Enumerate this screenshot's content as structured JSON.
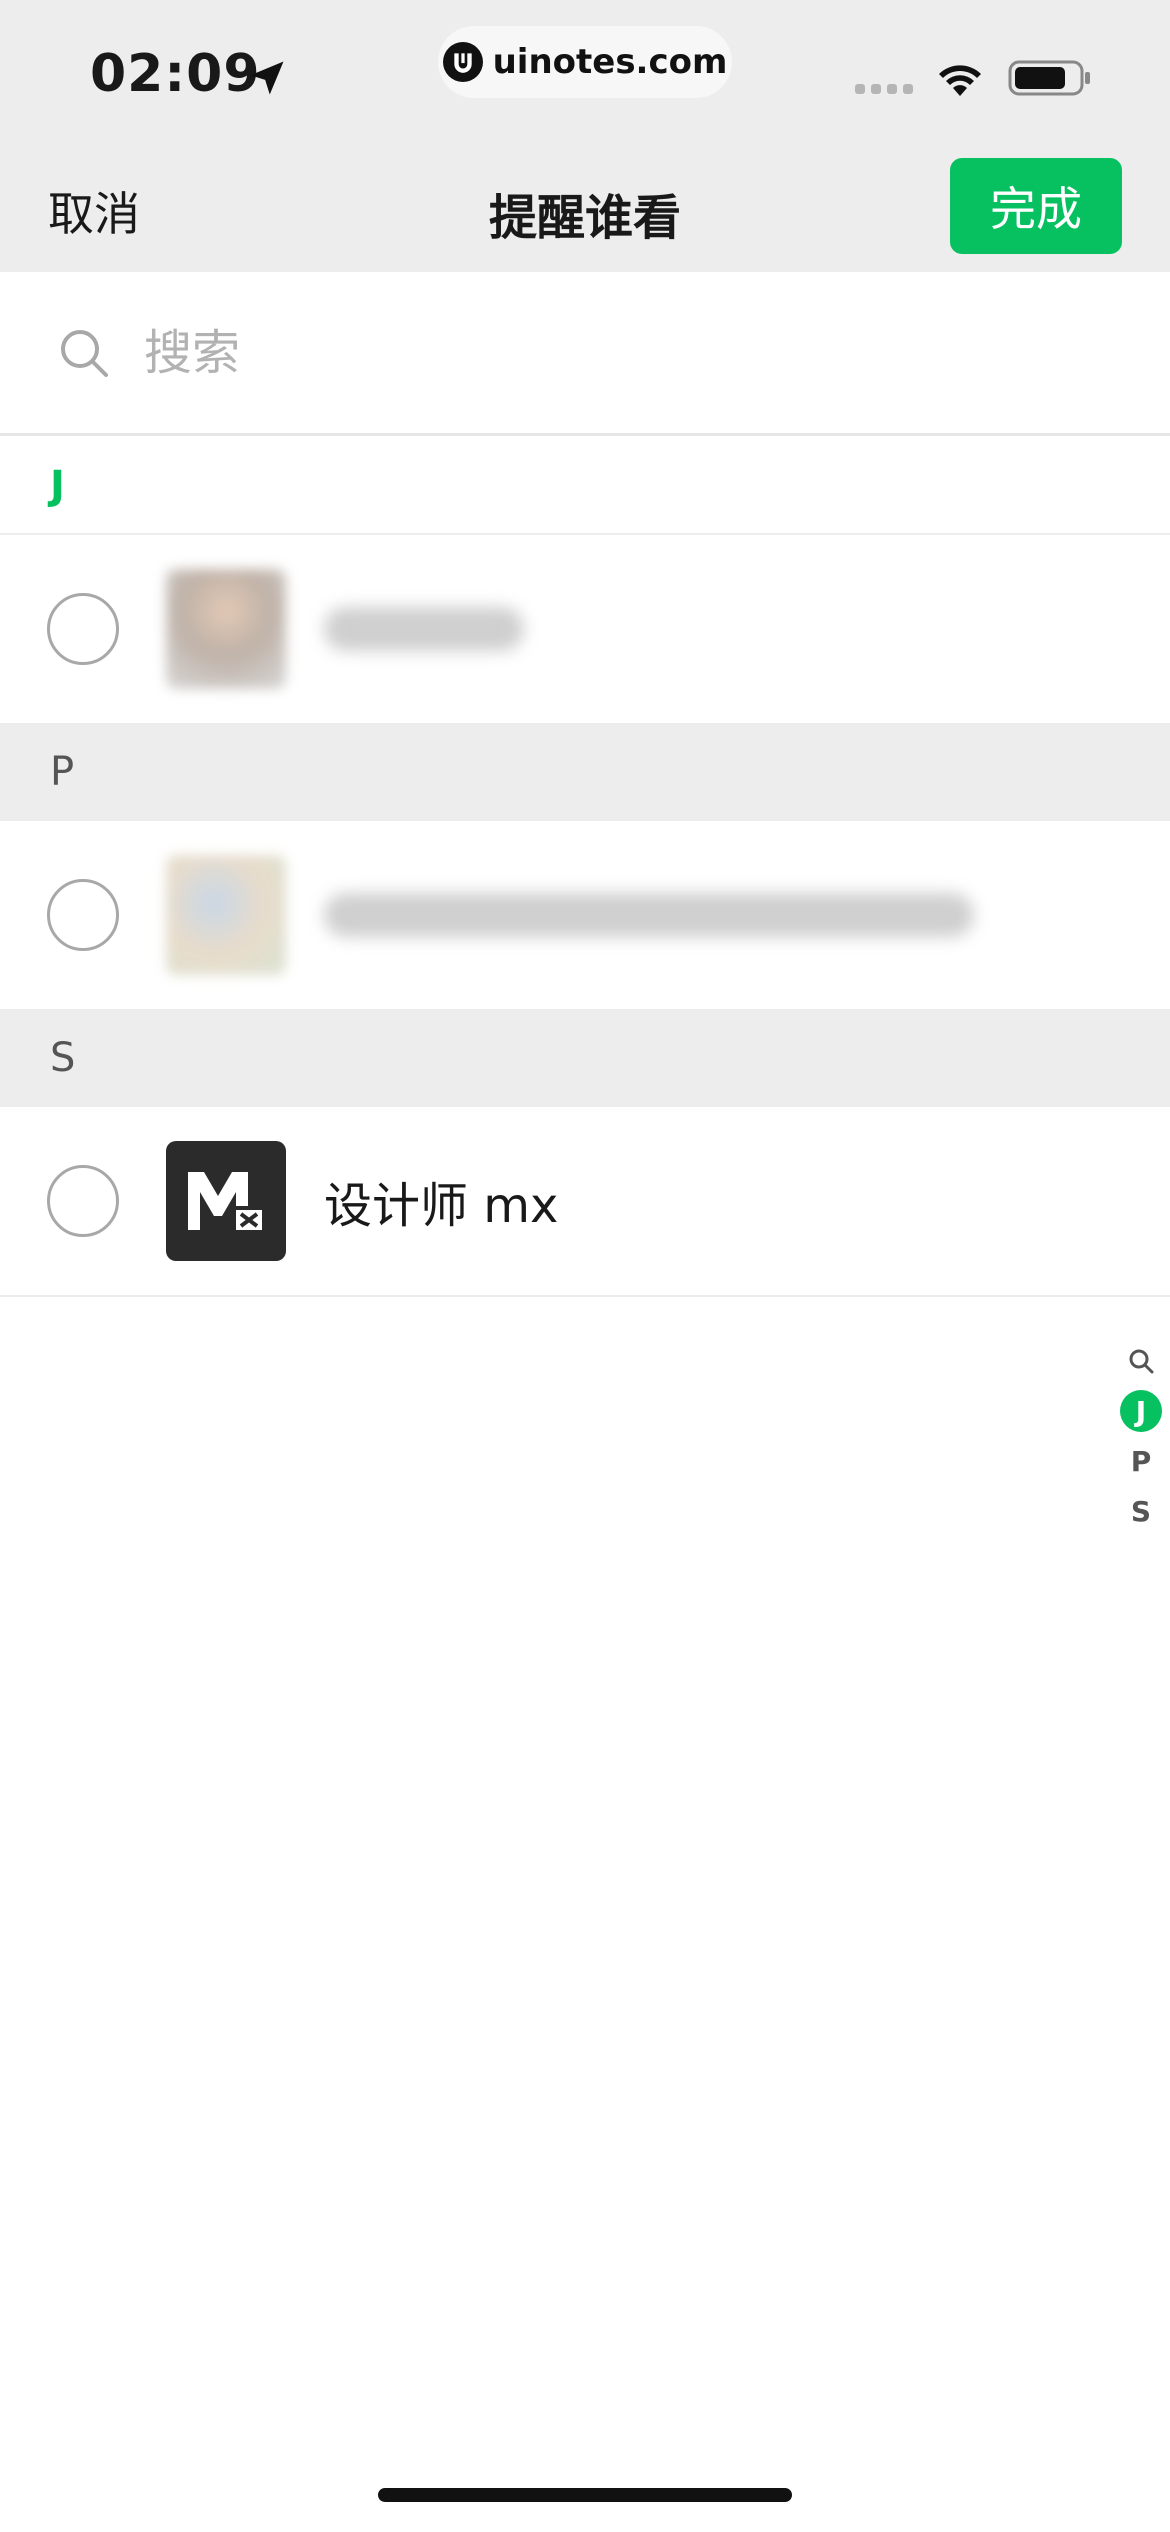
{
  "status_bar": {
    "time": "02:09",
    "url": "uinotes.com"
  },
  "nav": {
    "cancel_label": "取消",
    "title": "提醒谁看",
    "done_label": "完成"
  },
  "search": {
    "placeholder": "搜索"
  },
  "sections": [
    {
      "letter": "J"
    },
    {
      "letter": "P"
    },
    {
      "letter": "S"
    }
  ],
  "contacts": {
    "s_contact_name": "设计师 mx"
  },
  "index_bar": {
    "letters": [
      "J",
      "P",
      "S"
    ]
  },
  "colors": {
    "accent": "#07c160",
    "nav_bg": "#ededed"
  }
}
